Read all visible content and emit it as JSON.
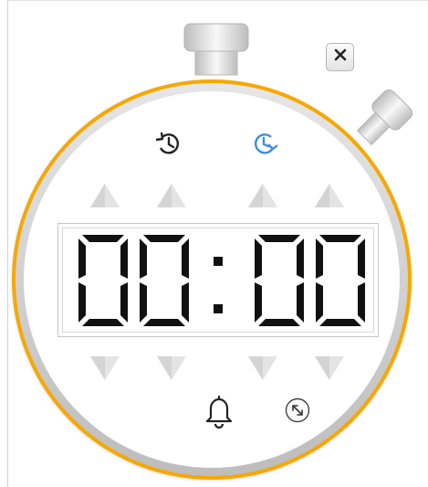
{
  "timer": {
    "minutes_tens": "0",
    "minutes_ones": "0",
    "separator": ":",
    "seconds_tens": "0",
    "seconds_ones": "0"
  },
  "controls": {
    "close_icon": "close-icon",
    "history_icon": "history-icon",
    "timer_icon": "timer-icon",
    "bell_icon": "bell-icon",
    "resize_icon": "expand-arrows-icon"
  },
  "colors": {
    "accent": "#f6a800",
    "timer_icon": "#3d8ee0",
    "digits": "#111111",
    "arrows": "#e2e2e2"
  }
}
